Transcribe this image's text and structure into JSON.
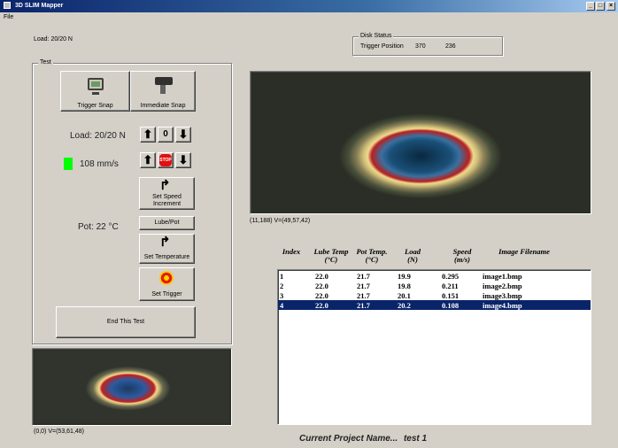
{
  "window": {
    "title": "3D SLIM Mapper",
    "minimize_glyph": "_",
    "maximize_glyph": "□",
    "close_glyph": "×"
  },
  "menu": {
    "file": "File"
  },
  "header": {
    "load_status": "Load: 20/20 N"
  },
  "disk_status": {
    "label": "Disk Status",
    "trigger_position_label": "Trigger Position",
    "value1": "370",
    "value2": "236"
  },
  "test_panel": {
    "label": "Test",
    "trigger_snap": "Trigger Snap",
    "immediate_snap": "Immediate Snap",
    "load_readout": "Load: 20/20 N",
    "load_up": "🡅",
    "load_value": "0",
    "load_down": "🡇",
    "speed_readout": "108 mm/s",
    "speed_up": "🡅",
    "stop_label": "STOP",
    "speed_down": "🡇",
    "set_speed_increment": "Set Speed Increment",
    "pot_readout": "Pot: 22 °C",
    "lube_pot": "Lube/Pot",
    "set_temperature": "Set Temperature",
    "set_trigger": "Set Trigger",
    "end_test": "End This Test",
    "speed_indicator_color": "#00ff00"
  },
  "main_view": {
    "status": "(11,188) V=(49,57,42)"
  },
  "preview_view": {
    "status": "(0,0) V=(53,61,48)"
  },
  "results_table": {
    "headers": {
      "index": "Index",
      "lube_temp": "Lube Temp",
      "lube_temp_unit": "(°C)",
      "pot_temp": "Pot Temp.",
      "pot_temp_unit": "(°C)",
      "load": "Load",
      "load_unit": "(N)",
      "speed": "Speed",
      "speed_unit": "(m/s)",
      "filename": "Image Filename"
    },
    "rows": [
      {
        "index": "1",
        "lube": "22.0",
        "pot": "21.7",
        "load": "19.9",
        "speed": "0.295",
        "file": "image1.bmp"
      },
      {
        "index": "2",
        "lube": "22.0",
        "pot": "21.7",
        "load": "19.8",
        "speed": "0.211",
        "file": "image2.bmp"
      },
      {
        "index": "3",
        "lube": "22.0",
        "pot": "21.7",
        "load": "20.1",
        "speed": "0.151",
        "file": "image3.bmp"
      },
      {
        "index": "4",
        "lube": "22.0",
        "pot": "21.7",
        "load": "20.2",
        "speed": "0.108",
        "file": "image4.bmp"
      }
    ],
    "selected_index": "4"
  },
  "footer": {
    "project_label": "Current Project Name...",
    "project_name": "test 1"
  }
}
